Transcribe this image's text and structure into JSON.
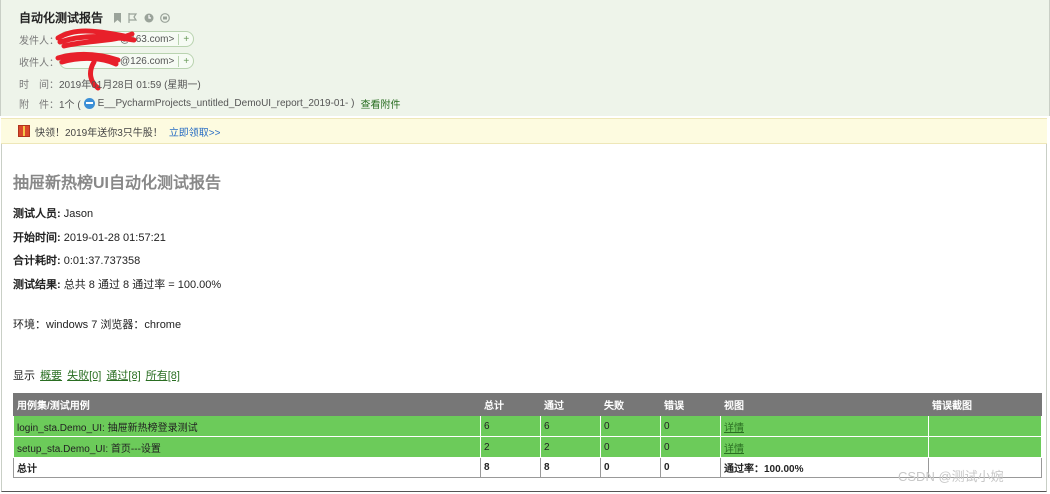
{
  "mail": {
    "subject": "自动化测试报告",
    "from_label": "发件人：",
    "from_addr": "@163.com>",
    "to_label": "收件人：",
    "to_addr": "@126.com>",
    "plus": "+",
    "time_label": "时　间：",
    "time_value": "2019年01月28日 01:59 (星期一)",
    "attach_label": "附　件：",
    "attach_count": "1个 (",
    "attach_name": "E__PycharmProjects_untitled_DemoUI_report_2019-01- )",
    "attach_link": "查看附件"
  },
  "promo": {
    "text": "快领！2019年送你3只牛股！",
    "link": "立即领取>>"
  },
  "report": {
    "title": "抽屉新热榜UI自动化测试报告",
    "tester_label": "测试人员:",
    "tester_value": " Jason",
    "start_label": "开始时间:",
    "start_value": " 2019-01-28 01:57:21",
    "duration_label": "合计耗时:",
    "duration_value": " 0:01:37.737358",
    "result_label": "测试结果:",
    "result_value": " 总共 8 通过 8 通过率 = 100.00%",
    "env": "环境：windows 7 浏览器：chrome",
    "filter_label": "显示",
    "filter_summary": "概要",
    "filter_fail": "失败[0]",
    "filter_pass": "通过[8]",
    "filter_all": "所有[8]"
  },
  "table": {
    "headers": [
      "用例集/测试用例",
      "总计",
      "通过",
      "失败",
      "错误",
      "视图",
      "错误截图"
    ],
    "rows": [
      {
        "name": "login_sta.Demo_UI: 抽屉新热榜登录测试",
        "total": "6",
        "pass": "6",
        "fail": "0",
        "error": "0",
        "view": "详情",
        "shot": ""
      },
      {
        "name": "setup_sta.Demo_UI: 首页---设置",
        "total": "2",
        "pass": "2",
        "fail": "0",
        "error": "0",
        "view": "详情",
        "shot": ""
      }
    ],
    "total_row": {
      "name": "总计",
      "total": "8",
      "pass": "8",
      "fail": "0",
      "error": "0",
      "rate": "通过率：100.00%"
    }
  },
  "watermark": "CSDN @测试小婉",
  "colors": {
    "pass_row": "#6ccb5a",
    "header_bg": "#777777",
    "mail_head_bg": "#eef4ea",
    "redaction": "#e8202a"
  }
}
